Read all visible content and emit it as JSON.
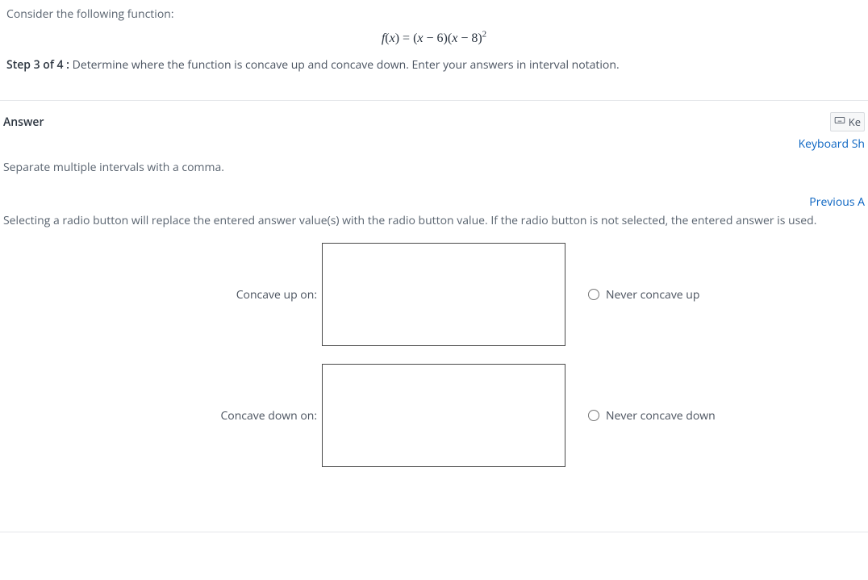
{
  "intro": "Consider the following function:",
  "formula": {
    "f": "f",
    "lhs_open": "(",
    "lhs_var": "x",
    "lhs_close": ")",
    "eq": " = ",
    "p1_open": "(",
    "p1_var": "x",
    "p1_op": " − ",
    "p1_num": "6",
    "p1_close": ")",
    "p2_open": "(",
    "p2_var": "x",
    "p2_op": " − ",
    "p2_num": "8",
    "p2_close": ")",
    "exp": "2"
  },
  "step_prefix": "Step 3 of 4 :",
  "step_text": "  Determine where the function is concave up and concave down. Enter your answers in interval notation.",
  "answer_title": "Answer",
  "keypad_label": "Ke",
  "keyboard_link": "Keyboard Sh",
  "separate_note": "Separate multiple intervals with a comma.",
  "previous_link": "Previous A",
  "radio_hint": "Selecting a radio button will replace the entered answer value(s) with the radio button value. If the radio button is not selected, the entered answer is used.",
  "rows": {
    "up": {
      "label": "Concave up on:",
      "radio": "Never concave up"
    },
    "down": {
      "label": "Concave down on:",
      "radio": "Never concave down"
    }
  }
}
